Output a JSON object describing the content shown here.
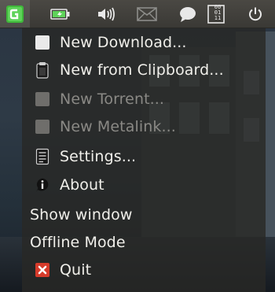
{
  "panel": {
    "icons": [
      {
        "name": "app-indicator-icon",
        "interactable": true
      },
      {
        "name": "battery-icon",
        "interactable": true
      },
      {
        "name": "volume-icon",
        "interactable": true
      },
      {
        "name": "mail-icon",
        "interactable": true
      },
      {
        "name": "chat-icon",
        "interactable": true
      },
      {
        "name": "binary-clock-icon",
        "interactable": true
      },
      {
        "name": "power-icon",
        "interactable": true
      }
    ],
    "binary_clock_digits": [
      "00",
      "01",
      "11"
    ]
  },
  "menu": {
    "items": [
      {
        "label": "New Download...",
        "icon": "new-download-icon",
        "enabled": true
      },
      {
        "label": "New from Clipboard...",
        "icon": "clipboard-icon",
        "enabled": true
      },
      {
        "label": "New Torrent...",
        "icon": "torrent-icon",
        "enabled": false
      },
      {
        "label": "New Metalink...",
        "icon": "metalink-icon",
        "enabled": false
      },
      {
        "label": "Settings...",
        "icon": "settings-icon",
        "enabled": true
      },
      {
        "label": "About",
        "icon": "info-icon",
        "enabled": true
      },
      {
        "label": "Show window",
        "icon": null,
        "enabled": true
      },
      {
        "label": "Offline Mode",
        "icon": null,
        "enabled": true
      },
      {
        "label": "Quit",
        "icon": "quit-icon",
        "enabled": true
      }
    ]
  },
  "colors": {
    "app_icon_green": "#3fb83a",
    "quit_red": "#d63b2b"
  }
}
